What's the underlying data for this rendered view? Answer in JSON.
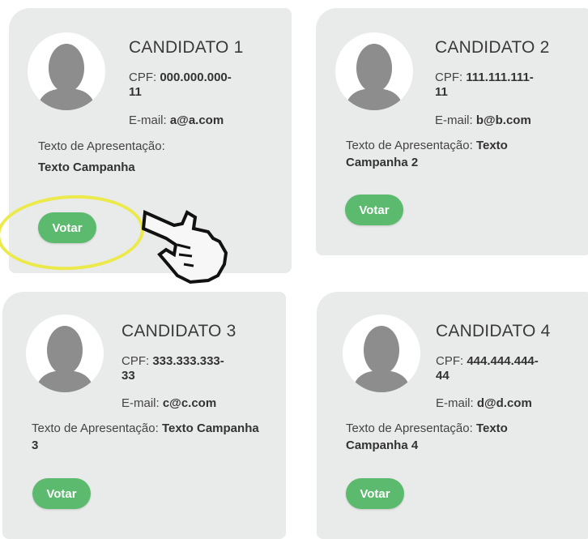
{
  "candidates": [
    {
      "name": "CANDIDATO 1",
      "cpf_label": "CPF:",
      "cpf_line1": "000.000.000-",
      "cpf_line2": "11",
      "email_label": "E-mail:",
      "email": "a@a.com",
      "text_label": "Texto de Apresentação:",
      "text_value": "Texto Campanha",
      "vote_label": "Votar"
    },
    {
      "name": "CANDIDATO 2",
      "cpf_label": "CPF:",
      "cpf_line1": "111.111.111-",
      "cpf_line2": "11",
      "email_label": "E-mail:",
      "email": "b@b.com",
      "text_label": "Texto de Apresentação:",
      "text_value": "Texto Campanha 2",
      "vote_label": "Votar"
    },
    {
      "name": "CANDIDATO 3",
      "cpf_label": "CPF:",
      "cpf_line1": "333.333.333-",
      "cpf_line2": "33",
      "email_label": "E-mail:",
      "email": "c@c.com",
      "text_label": "Texto de Apresentação:",
      "text_value": "Texto Campanha 3",
      "vote_label": "Votar"
    },
    {
      "name": "CANDIDATO 4",
      "cpf_label": "CPF:",
      "cpf_line1": "444.444.444-",
      "cpf_line2": "44",
      "email_label": "E-mail:",
      "email": "d@d.com",
      "text_label": "Texto de Apresentação:",
      "text_value": "Texto Campanha 4",
      "vote_label": "Votar"
    }
  ],
  "colors": {
    "card": "#e9eaea",
    "vote_button": "#5cba6e",
    "highlight": "#ece94a"
  },
  "icons": {
    "avatar": "person-silhouette-icon",
    "pointer": "hand-pointer-icon"
  }
}
